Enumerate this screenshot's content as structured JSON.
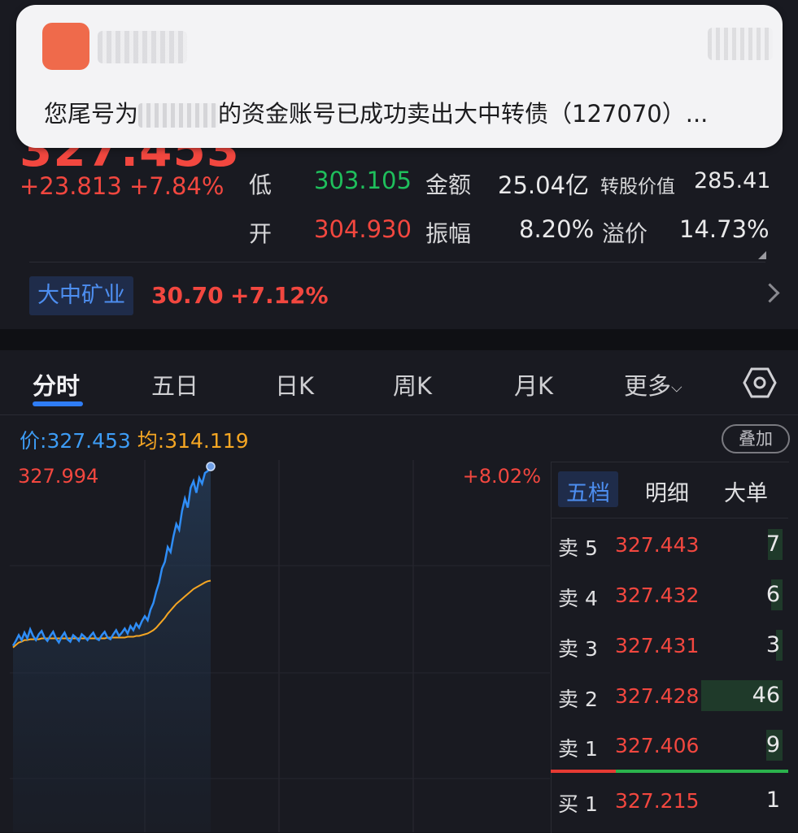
{
  "quote": {
    "price": "327.453",
    "change": "+23.813",
    "change_pct": "+7.84%",
    "low_label": "低",
    "low": "303.105",
    "open_label": "开",
    "open": "304.930",
    "amount_label": "金额",
    "amount": "25.04亿",
    "amplitude_label": "振幅",
    "amplitude": "8.20%",
    "conv_value_label": "转股价值",
    "conv_value": "285.41",
    "premium_label": "溢价",
    "premium": "14.73%"
  },
  "stock": {
    "name": "大中矿业",
    "price": "30.70",
    "change_pct": "+7.12%"
  },
  "tabs": [
    "分时",
    "五日",
    "日K",
    "周K",
    "月K",
    "更多"
  ],
  "chart_header": {
    "price_label": "价:",
    "price": "327.453",
    "avg_label": "均:",
    "avg": "314.119",
    "overlay": "叠加"
  },
  "chart_labels": {
    "high": "327.994",
    "high_pct": "+8.02%"
  },
  "notification": {
    "text_before": "您尾号为",
    "text_after": "的资金账号已成功卖出大中转债（127070）..."
  },
  "book": {
    "tabs": [
      "五档",
      "明细",
      "大单"
    ],
    "rows": [
      {
        "label": "卖 5",
        "price": "327.443",
        "vol": "7"
      },
      {
        "label": "卖 4",
        "price": "327.432",
        "vol": "6"
      },
      {
        "label": "卖 3",
        "price": "327.431",
        "vol": "3"
      },
      {
        "label": "卖 2",
        "price": "327.428",
        "vol": "46"
      },
      {
        "label": "卖 1",
        "price": "327.406",
        "vol": "9"
      },
      {
        "label": "买 1",
        "price": "327.215",
        "vol": "1"
      }
    ]
  },
  "colors": {
    "up": "#f2473f",
    "down": "#1fbf5c",
    "accent": "#2f7df6",
    "avg_line": "#f5a623"
  },
  "chart_data": {
    "type": "line",
    "series": [
      {
        "name": "价",
        "values": [
          306.2,
          306.8,
          307.5,
          306.9,
          307.8,
          307.1,
          308.2,
          307.4,
          306.9,
          307.6,
          308.0,
          307.2,
          306.8,
          307.4,
          307.9,
          307.1,
          306.6,
          307.3,
          307.8,
          307.0,
          306.7,
          307.5,
          307.2,
          306.8,
          307.6,
          307.3,
          306.9,
          307.4,
          307.8,
          307.1,
          306.9,
          307.5,
          307.9,
          307.2,
          307.0,
          307.6,
          308.1,
          307.4,
          307.8,
          308.3,
          307.7,
          308.6,
          308.1,
          308.9,
          308.4,
          309.2,
          309.8,
          309.3,
          310.6,
          311.4,
          312.8,
          313.9,
          315.6,
          316.4,
          318.2,
          317.6,
          319.5,
          321.0,
          320.3,
          322.6,
          324.1,
          323.0,
          325.4,
          326.2,
          324.8,
          326.6,
          325.9,
          327.2,
          327.453,
          327.994
        ]
      },
      {
        "name": "均",
        "values": [
          306.0,
          306.3,
          306.6,
          306.7,
          306.9,
          306.9,
          307.0,
          307.0,
          307.0,
          307.0,
          307.1,
          307.1,
          307.1,
          307.1,
          307.1,
          307.1,
          307.1,
          307.1,
          307.1,
          307.1,
          307.1,
          307.1,
          307.1,
          307.1,
          307.1,
          307.1,
          307.1,
          307.1,
          307.1,
          307.1,
          307.1,
          307.1,
          307.1,
          307.2,
          307.2,
          307.2,
          307.2,
          307.2,
          307.2,
          307.2,
          307.3,
          307.3,
          307.3,
          307.4,
          307.4,
          307.5,
          307.6,
          307.7,
          307.9,
          308.1,
          308.4,
          308.8,
          309.2,
          309.6,
          310.1,
          310.5,
          310.9,
          311.3,
          311.6,
          311.9,
          312.2,
          312.5,
          312.8,
          313.1,
          313.3,
          313.5,
          313.7,
          313.9,
          314.05,
          314.119
        ]
      }
    ],
    "ylim": [
      303.105,
      327.994
    ],
    "grid": true
  }
}
